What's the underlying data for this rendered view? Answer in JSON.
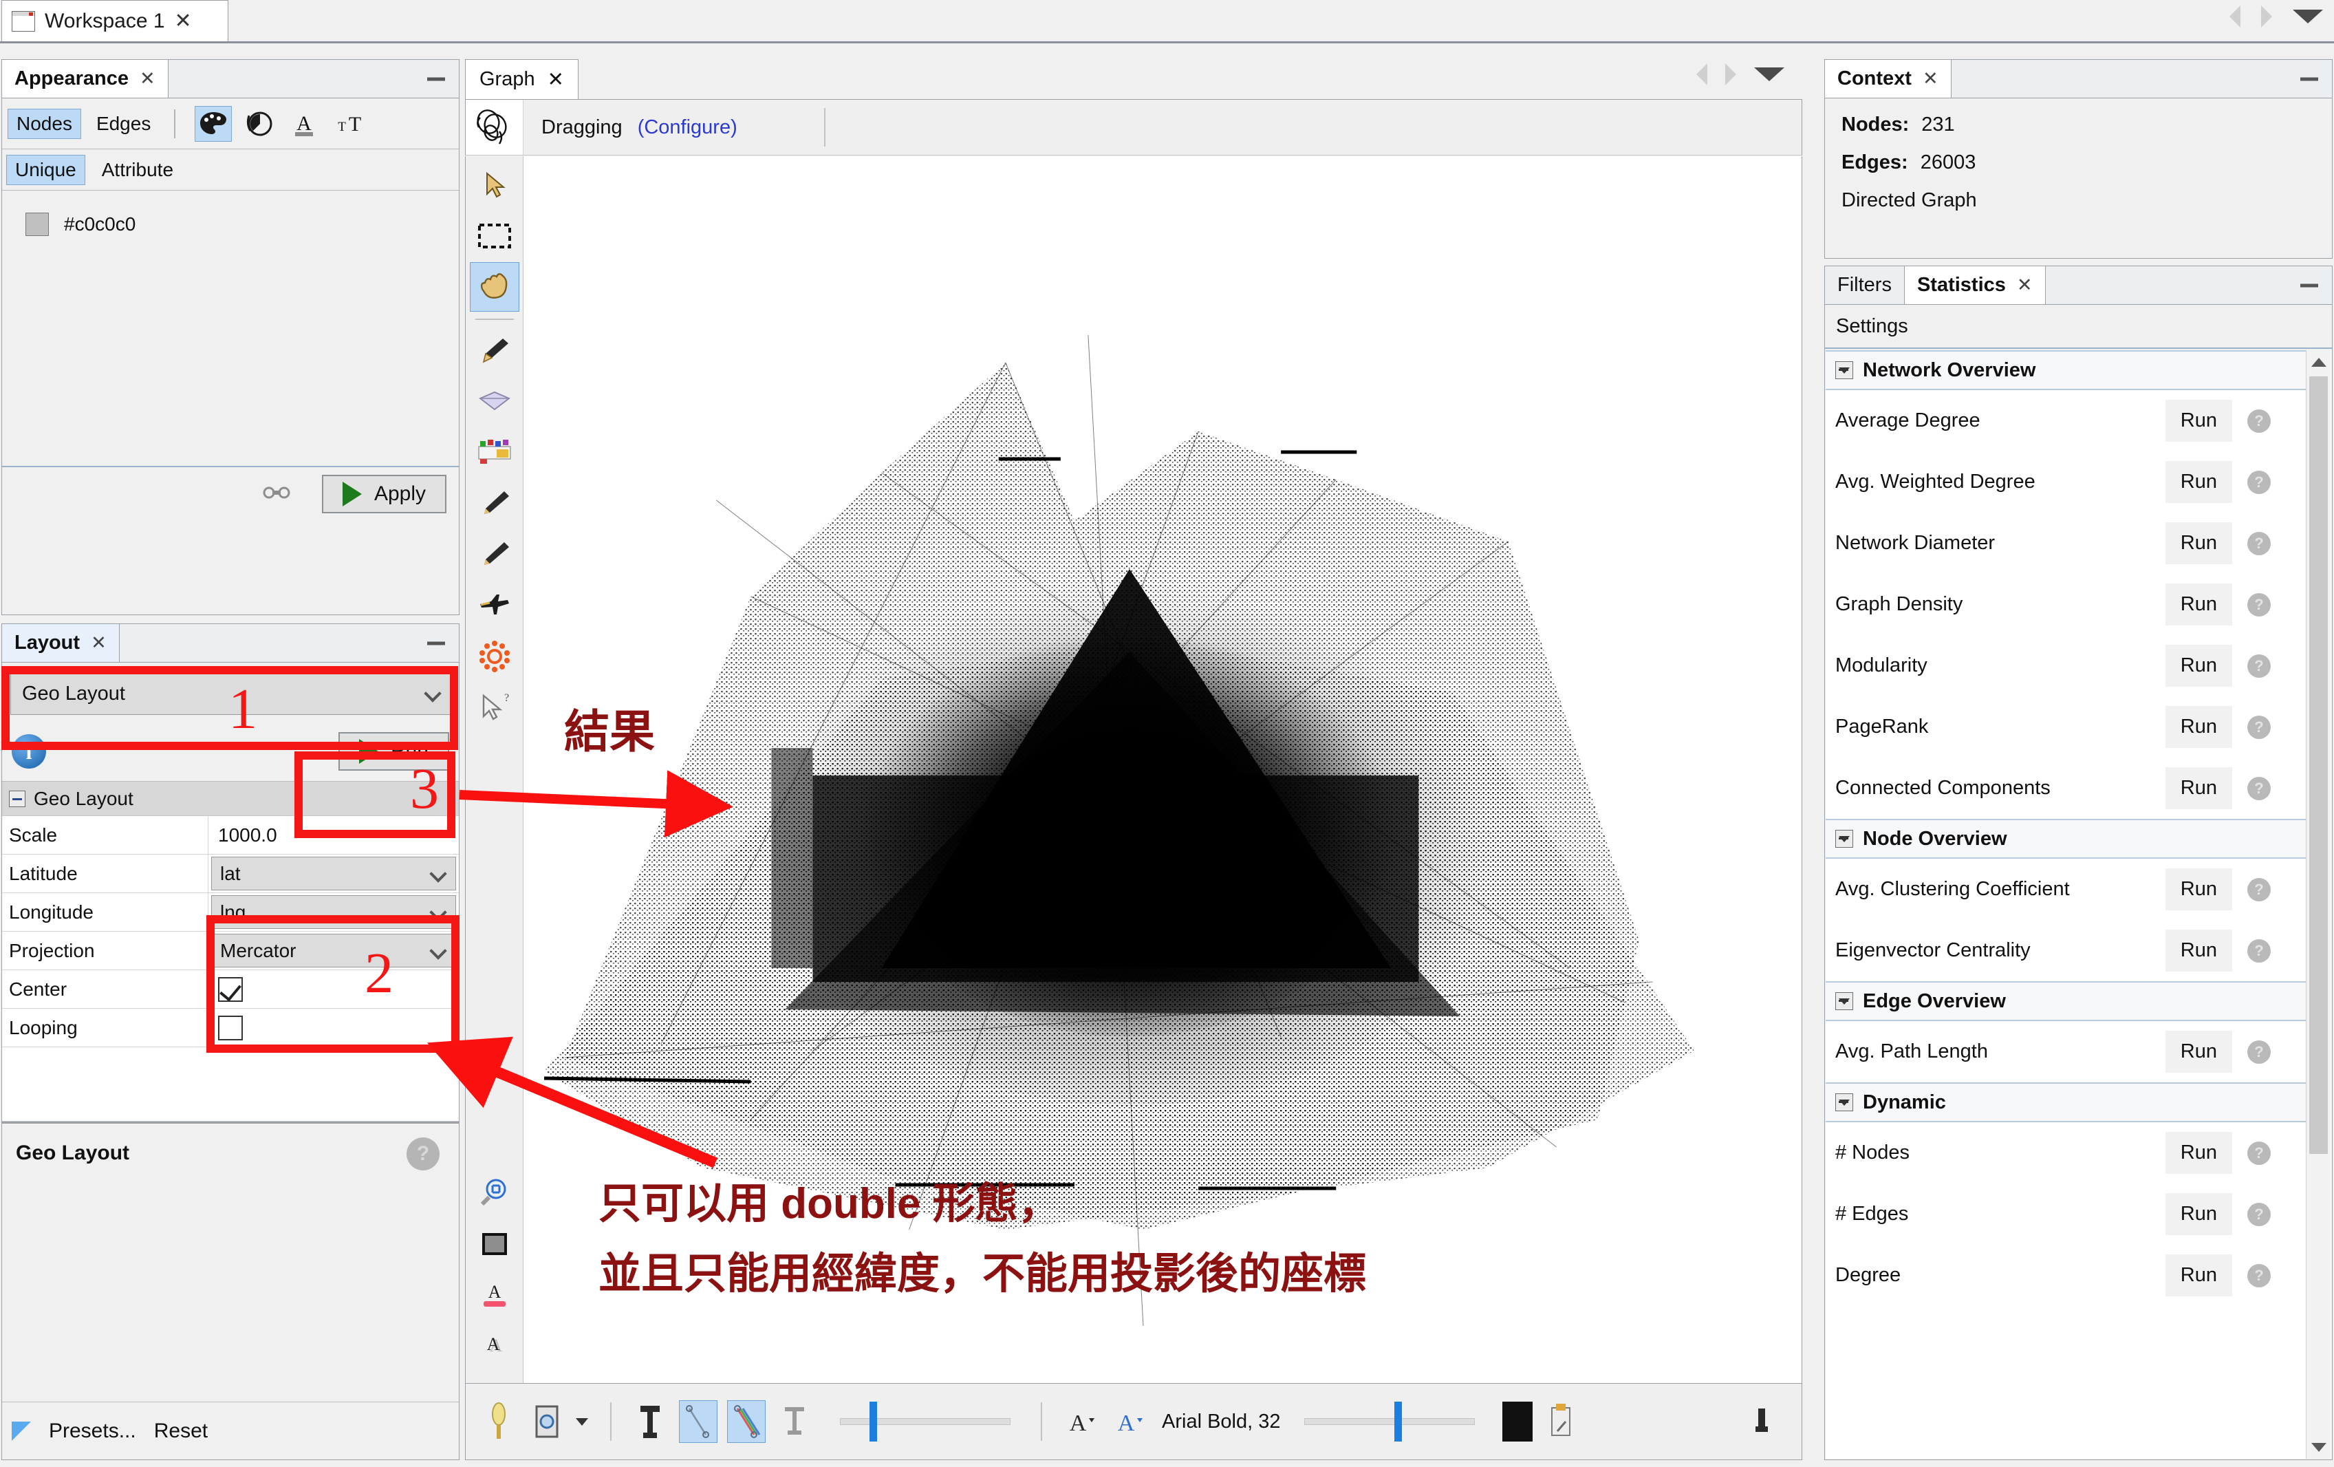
{
  "workspace": {
    "tab_label": "Workspace 1",
    "close": "✕"
  },
  "appearance": {
    "tab_title": "Appearance",
    "tab_close": "✕",
    "minimize": "—",
    "target_tabs": [
      {
        "label": "Nodes",
        "selected": true
      },
      {
        "label": "Edges",
        "selected": false
      }
    ],
    "mode_icons": [
      {
        "name": "palette-icon",
        "glyph": "●",
        "selected": true
      },
      {
        "name": "node-size-icon",
        "glyph": "◔",
        "selected": false
      },
      {
        "name": "label-color-icon",
        "glyph": "A",
        "selected": false
      },
      {
        "name": "label-size-icon",
        "glyph": "ᴛT",
        "selected": false
      }
    ],
    "partition_tabs": [
      {
        "label": "Unique",
        "selected": true
      },
      {
        "label": "Attribute",
        "selected": false
      }
    ],
    "color_value": "#c0c0c0",
    "color_swatch_hex": "#c0c0c0",
    "apply_label": "Apply"
  },
  "layout": {
    "tab_title": "Layout",
    "tab_close": "✕",
    "minimize": "—",
    "selected_layout": "Geo Layout",
    "run_label": "Run",
    "properties_group": "Geo Layout",
    "properties": [
      {
        "name": "Scale",
        "value": "1000.0",
        "type": "text"
      },
      {
        "name": "Latitude",
        "value": "lat",
        "type": "combo"
      },
      {
        "name": "Longitude",
        "value": "lng",
        "type": "combo"
      },
      {
        "name": "Projection",
        "value": "Mercator",
        "type": "combo"
      },
      {
        "name": "Center",
        "value": "checked",
        "type": "checkbox"
      },
      {
        "name": "Looping",
        "value": "unchecked",
        "type": "checkbox"
      }
    ],
    "description_title": "Geo Layout",
    "presets_label": "Presets...",
    "reset_label": "Reset"
  },
  "graph": {
    "tab_title": "Graph",
    "tab_close": "✕",
    "mode_label": "Dragging",
    "configure_label": "(Configure)",
    "left_tools": [
      {
        "name": "cursor-select-icon",
        "selected": false
      },
      {
        "name": "rectangle-selection-icon",
        "selected": false
      },
      {
        "name": "hand-drag-icon",
        "selected": true
      },
      {
        "name": "brush-paint-icon",
        "selected": false
      },
      {
        "name": "diamond-size-icon",
        "selected": false
      },
      {
        "name": "color-palette-icon",
        "selected": false
      },
      {
        "name": "pencil-edit-icon",
        "selected": false
      },
      {
        "name": "pencil-edge-icon",
        "selected": false
      },
      {
        "name": "airplane-shortest-path-icon",
        "selected": false
      },
      {
        "name": "heatmap-gear-icon",
        "selected": false
      },
      {
        "name": "cursor-help-icon",
        "selected": false
      }
    ],
    "lower_tools": [
      {
        "name": "zoom-fit-icon"
      },
      {
        "name": "background-color-icon"
      },
      {
        "name": "label-color-icon"
      },
      {
        "name": "label-shadow-icon"
      }
    ],
    "bottom_bar": {
      "font_label": "Arial Bold, 32",
      "icons": [
        {
          "name": "show-labels-icon"
        },
        {
          "name": "screenshot-icon"
        },
        {
          "name": "screenshot-dropdown-icon"
        },
        {
          "name": "node-labels-icon"
        },
        {
          "name": "edge-thin-icon",
          "selected": true
        },
        {
          "name": "edge-color-icon",
          "selected": true
        },
        {
          "name": "edge-label-icon"
        },
        {
          "name": "font-decrease-icon"
        },
        {
          "name": "font-increase-icon"
        },
        {
          "name": "label-color-chip-icon"
        },
        {
          "name": "label-settings-icon"
        },
        {
          "name": "reset-icon"
        }
      ]
    }
  },
  "context": {
    "tab_title": "Context",
    "tab_close": "✕",
    "minimize": "—",
    "nodes_label": "Nodes:",
    "nodes_value": "231",
    "edges_label": "Edges:",
    "edges_value": "26003",
    "graph_type": "Directed Graph"
  },
  "statistics": {
    "tabs": [
      {
        "label": "Filters",
        "selected": false
      },
      {
        "label": "Statistics",
        "selected": true,
        "close": "✕"
      }
    ],
    "minimize": "—",
    "settings_label": "Settings",
    "run_label": "Run",
    "groups": [
      {
        "title": "Network Overview",
        "items": [
          "Average Degree",
          "Avg. Weighted Degree",
          "Network Diameter",
          "Graph Density",
          "Modularity",
          "PageRank",
          "Connected Components"
        ]
      },
      {
        "title": "Node Overview",
        "items": [
          "Avg. Clustering Coefficient",
          "Eigenvector Centrality"
        ]
      },
      {
        "title": "Edge Overview",
        "items": [
          "Avg. Path Length"
        ]
      },
      {
        "title": "Dynamic",
        "items": [
          "# Nodes",
          "# Edges",
          "Degree"
        ]
      }
    ]
  },
  "annotations": {
    "accent_color": "#f51616",
    "text_color": "#8c1212",
    "marker_1": "1",
    "marker_2": "2",
    "marker_3": "3",
    "result_label": "結果",
    "note_line1": "只可以用 double 形態，",
    "note_line2": "並且只能用經緯度，不能用投影後的座標"
  }
}
